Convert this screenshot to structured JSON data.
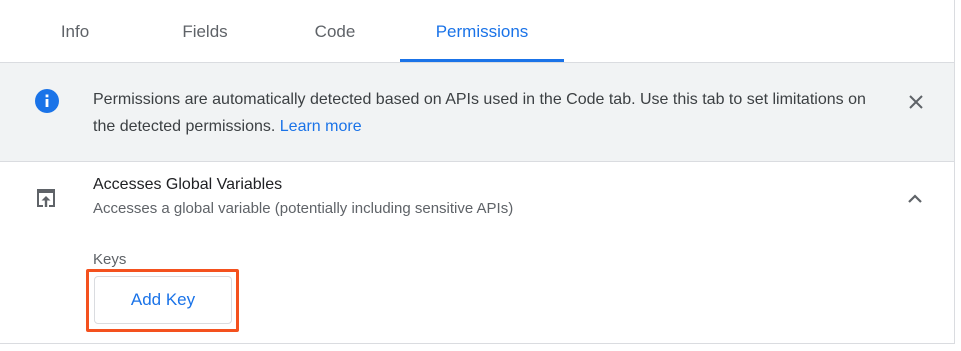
{
  "tabs": [
    {
      "label": "Info"
    },
    {
      "label": "Fields"
    },
    {
      "label": "Code"
    },
    {
      "label": "Permissions",
      "active": true
    }
  ],
  "banner": {
    "icon": "info-icon",
    "text": "Permissions are automatically detected based on APIs used in the Code tab. Use this tab to set limitations on the detected permissions.",
    "link_label": "Learn more",
    "close_icon": "close-icon"
  },
  "permission": {
    "icon": "open-in-new-window-icon",
    "title": "Accesses Global Variables",
    "subtitle": "Accesses a global variable (potentially including sensitive APIs)",
    "collapse_icon": "chevron-up-icon",
    "keys_label": "Keys",
    "add_key_label": "Add Key"
  },
  "colors": {
    "accent": "#1a73e8",
    "highlight": "#f4511e",
    "banner_bg": "#f1f3f4"
  }
}
